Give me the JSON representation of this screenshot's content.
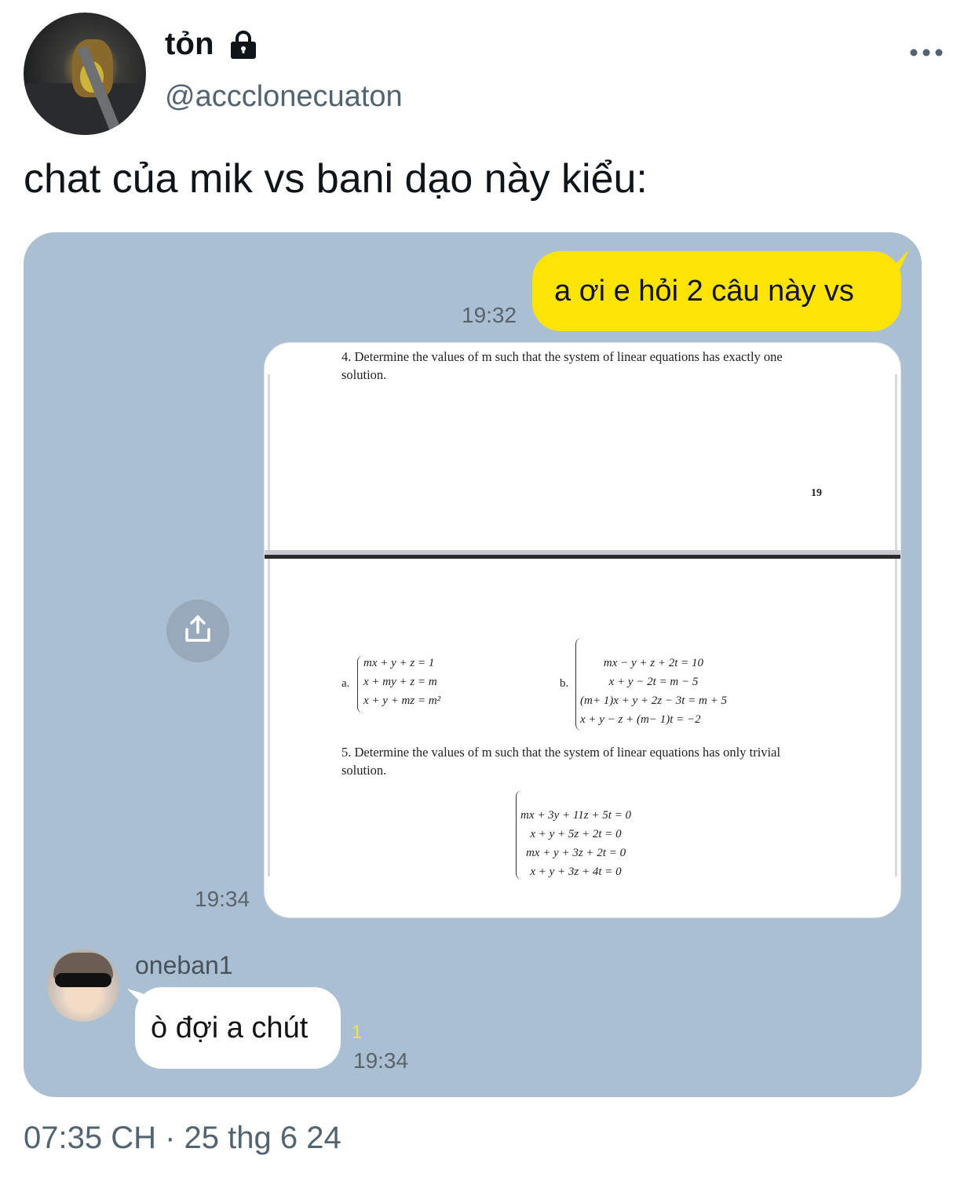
{
  "header": {
    "display_name": "tỏn",
    "handle": "@accclonecuaton",
    "lock_icon": "lock-icon",
    "more_icon": "more-horizontal-icon"
  },
  "tweet": {
    "text": "chat của mik vs bani dạo này kiểu:",
    "timestamp": "07:35 CH · 25 thg 6 24"
  },
  "chat": {
    "background": "#abbfd2",
    "my_bubble_color": "#fde404",
    "messages": [
      {
        "sender": "me",
        "text": "a ơi e hỏi 2 câu này vs",
        "time": "19:32"
      },
      {
        "sender": "me",
        "type": "photo",
        "time": "19:34"
      },
      {
        "sender": "oneban1",
        "name": "oneban1",
        "text": "ò đợi a chút",
        "time": "19:34",
        "unread": "1"
      }
    ],
    "share_icon": "share-upload-icon"
  },
  "photo": {
    "q4_line1": "4. Determine the values of m such that the system of linear equations has exactly one",
    "q4_line2": "solution.",
    "page_number": "19",
    "sys_a_label": "a.",
    "sys_a": [
      "mx + y + z = 1",
      "x + my + z = m",
      "x + y + mz = m²"
    ],
    "sys_b_label": "b.",
    "sys_b": [
      "mx − y + z + 2t = 10",
      "x + y − 2t = m − 5",
      "(m+ 1)x + y + 2z − 3t = m + 5",
      "x + y − z + (m− 1)t = −2"
    ],
    "q5_line1": "5. Determine the values of m such that the system of linear equations has only trivial",
    "q5_line2": "solution.",
    "sys_c": [
      "mx + 3y + 11z + 5t = 0",
      "x + y + 5z + 2t = 0",
      "mx + y + 3z + 2t = 0",
      "x + y + 3z + 4t = 0"
    ]
  }
}
